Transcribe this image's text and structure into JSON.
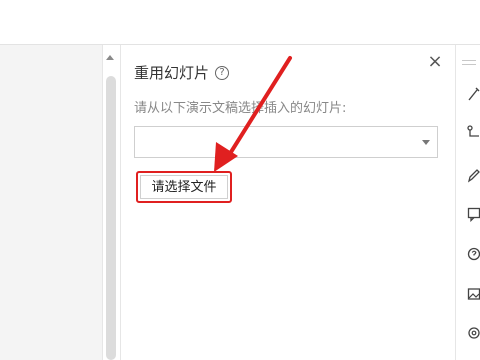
{
  "panel": {
    "title": "重用幻灯片",
    "help_icon": "?",
    "close_icon": "×",
    "instruction": "请从以下演示文稿选择插入的幻灯片:",
    "dropdown_value": "",
    "file_button_label": "请选择文件"
  },
  "annotation": {
    "arrow_color": "#e02020",
    "highlight_color": "#e02020"
  },
  "right_toolbar": {
    "icons": [
      "magic-icon",
      "connector-icon",
      "pen-icon",
      "comment-icon",
      "help-icon",
      "image-icon",
      "settings-icon"
    ]
  }
}
